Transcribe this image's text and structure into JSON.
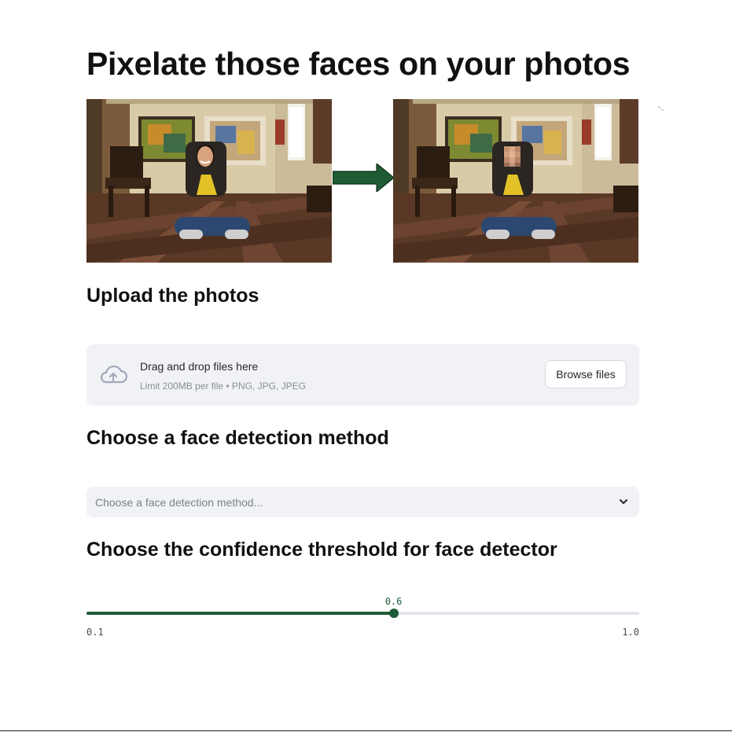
{
  "title": "Pixelate those faces on your photos",
  "hero": {
    "before_image": "room-photo-original",
    "arrow_icon": "arrow-right-icon",
    "after_image": "room-photo-face-pixelated",
    "arrow_color": "#1f5c34"
  },
  "upload": {
    "heading": "Upload the photos",
    "icon": "cloud-upload-icon",
    "instruction": "Drag and drop files here",
    "limits": "Limit 200MB per file • PNG, JPG, JPEG",
    "browse_label": "Browse files"
  },
  "method": {
    "heading": "Choose a face detection method",
    "placeholder": "Choose a face detection method...",
    "icon": "chevron-down-icon"
  },
  "threshold": {
    "heading": "Choose the confidence threshold for face detector",
    "min": 0.1,
    "max": 1.0,
    "value": 0.6,
    "value_label": "0.6",
    "min_label": "0.1",
    "max_label": "1.0"
  },
  "colors": {
    "accent": "#1e5b37",
    "panel_bg": "#f0f2f6",
    "track": "#e2e5ea"
  }
}
